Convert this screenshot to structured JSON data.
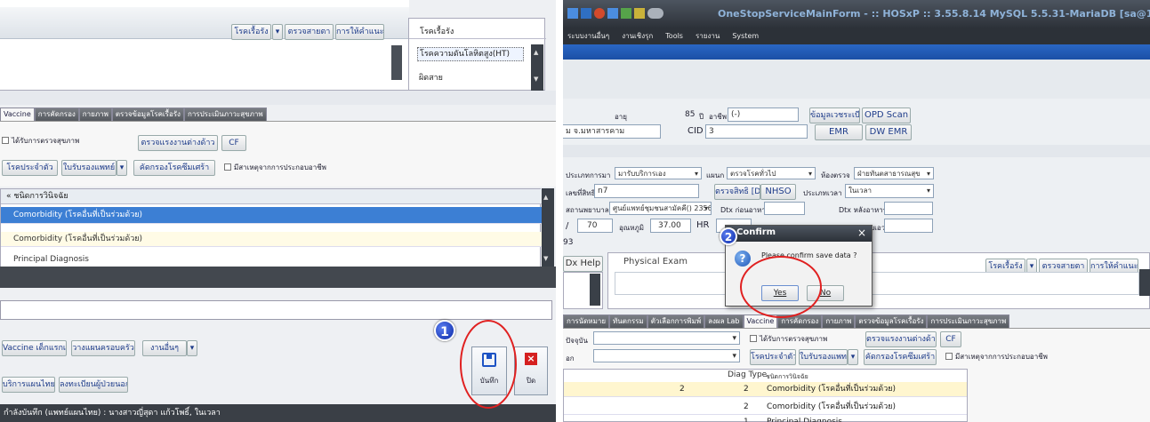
{
  "left": {
    "top_buttons": [
      "โรคเรื้อรัง",
      "ตรวจสายตา",
      "การให้คำแนะนำ"
    ],
    "chronic_header": "โรคเรื้อรัง",
    "chronic_items": [
      "โรคความดันโลหิตสูง(HT)",
      "ผิดสาย"
    ],
    "tabs": [
      "Vaccine",
      "การคัดกรอง",
      "กายภาพ",
      "ตรวจข้อมูลโรคเรื้อรัง",
      "การประเมินภาวะสุขภาพ"
    ],
    "checkup_checkbox": "ได้รับการตรวจสุขภาพ",
    "buttons_row1": [
      "ตรวจแรงงานต่างด้าว",
      "CF"
    ],
    "buttons_row2": [
      "โรคประจำตัว",
      "ใบรับรองแพทย์",
      "คัดกรองโรคซึมเศร้า"
    ],
    "risk_checkbox": "มีสาเหตุจากการประกอบอาชีพ",
    "diag_header": "ชนิดการวินิจฉัย",
    "diag_rows": [
      "Comorbidity (โรคอื่นที่เป็นร่วมด้วย)",
      "Comorbidity (โรคอื่นที่เป็นร่วมด้วย)",
      "Principal Diagnosis"
    ],
    "bottom_buttons_row1": [
      "Vaccine เด็กแรกเกิด",
      "วางแผนครอบครัว",
      "งานอื่นๆ"
    ],
    "bottom_buttons_row2": [
      "บริการแผนไทย",
      "ลงทะเบียนผู้ป่วยนอก"
    ],
    "status_text": "กำลังบันทึก (แพทย์แผนไทย) : นางสาวญี่สุดา แก้วโพธิ์, ในเวลา",
    "save_label": "บันทึก",
    "close_label": "ปิด",
    "badge1": "1"
  },
  "right": {
    "title": "OneStopServiceMainForm - :: HOSxP :: 3.55.8.14 MySQL 5.5.31-MariaDB [sa@1",
    "menu": [
      "ระบบงานอื่นๆ",
      "งานเชิงรุก",
      "Tools",
      "รายงาน",
      "System"
    ],
    "age_label": "อายุ",
    "age_value": "85",
    "year_label": "ปี",
    "occupation_label": "อาชีพ",
    "occupation_value": "(-)",
    "btn_patient_info": "ข้อมูลเวชระเบียน",
    "btn_opd_scan": "OPD Scan",
    "province": "ม จ.มหาสารคาม",
    "cid_label": "CID",
    "cid_value": "3",
    "btn_emr": "EMR",
    "btn_dwemr": "DW EMR",
    "service_type_label": "ประเภทการมา",
    "service_type_value": "มารับบริการเอง",
    "dept_label": "แผนก",
    "dept_value": "ตรวจโรคทั่วไป",
    "room_label": "ห้องตรวจ",
    "room_value": "ฝ่ายทันตสาธารณสุข",
    "right_no_label": "เลขที่สิทธิ",
    "right_no_value": "n7",
    "btn_right_dw": "ตรวจสิทธิ [DW]",
    "btn_nhso": "NHSO",
    "time_type_label": "ประเภทเวลา",
    "time_type_value": "ในเวลา",
    "hospital_label": "สถานพยาบาลรอง",
    "hospital_value": "ศูนย์แพทย์ชุมชนสามัคคี() 23564",
    "dtx_before_label": "Dtx ก่อนอาหาร",
    "dtx_after_label": "Dtx หลังอาหาร",
    "bp_value": "70",
    "temp_label": "อุณหภูมิ",
    "temp_value": "37.00",
    "hr_label": "HR",
    "waist_label": "รอบเอว",
    "sub_value": "93",
    "tab_dx_help": "Dx Help",
    "tab_physical_exam": "Physical Exam",
    "top_buttons": [
      "โรคเรื้อรัง",
      "ตรวจสายตา",
      "การให้คำแนะนำ"
    ],
    "tabs": [
      "การนัดหมาย",
      "ทันตกรรม",
      "ตัวเลือกการพิมพ์",
      "ลงผล Lab",
      "Vaccine",
      "การคัดกรอง",
      "กายภาพ",
      "ตรวจข้อมูลโรคเรื้อรัง",
      "การประเมินภาวะสุขภาพ"
    ],
    "current_label": "ปัจจุบัน",
    "other_label": "อก",
    "checkup_checkbox": "ได้รับการตรวจสุขภาพ",
    "btn_foreign": "ตรวจแรงงานต่างด้าว",
    "btn_cf": "CF",
    "btn_disease": "โรคประจำตัว",
    "btn_certificate": "ใบรับรองแพทย์",
    "btn_depression": "คัดกรองโรคซึมเศร้า",
    "risk_checkbox": "มีสาเหตุจากการประกอบอาชีพ",
    "grid_headers": [
      "Diag Type",
      "ชนิดการวินิจฉัย"
    ],
    "grid_rows": [
      {
        "num": "2",
        "type": "2",
        "name": "Comorbidity (โรคอื่นที่เป็นร่วมด้วย)"
      },
      {
        "num": "",
        "type": "2",
        "name": "Comorbidity (โรคอื่นที่เป็นร่วมด้วย)"
      },
      {
        "num": "",
        "type": "1",
        "name": "Principal Diagnosis"
      }
    ],
    "badge2": "2"
  },
  "dialog": {
    "title": "Confirm",
    "message": "Please confirm save data ?",
    "yes": "Yes",
    "no": "No",
    "close": "×"
  }
}
